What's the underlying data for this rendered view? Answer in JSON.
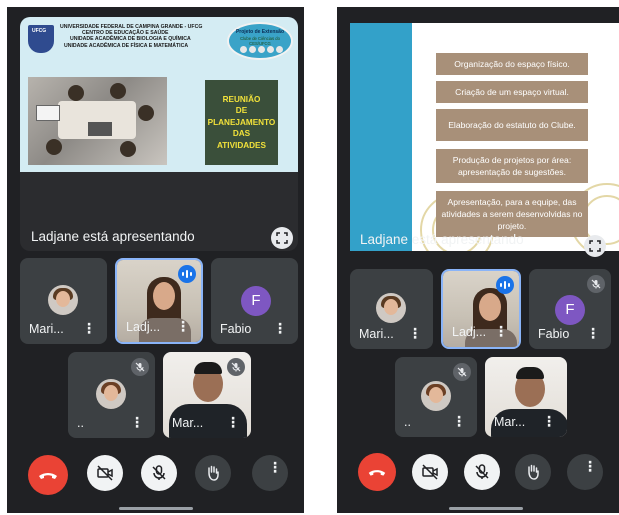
{
  "left_screen": {
    "slide": {
      "university_lines": [
        "UNIVERSIDADE FEDERAL DE CAMPINA GRANDE - UFCG",
        "CENTRO DE EDUCAÇÃO E SAÚDE",
        "UNIDADE ACADÊMICA DE BIOLOGIA E QUÍMICA",
        "UNIDADE ACADÊMICA DE FÍSICA E MATEMÁTICA"
      ],
      "logo_text": "UFCG",
      "badge_title": "Projeto de Extensão",
      "badge_subtitle": "Clube de Ciências do CES/UFCG",
      "title": "REUNIÃO\nDE\nPLANEJAMENTO\nDAS\nATIVIDADES"
    },
    "presenting_label": "Ladjane está apresentando",
    "participants": [
      {
        "name": "Mari...",
        "more": "⋮"
      },
      {
        "name": "Ladj...",
        "more": "⋮"
      },
      {
        "name": "Fabio",
        "more": "⋮",
        "initial": "F"
      },
      {
        "name": "..",
        "more": "⋮"
      },
      {
        "name": "Mar...",
        "more": "⋮"
      }
    ]
  },
  "right_screen": {
    "slide_items": [
      "Organização do espaço físico.",
      "Criação de um espaço virtual.",
      "Elaboração do estatuto do Clube.",
      "Produção de projetos por área: apresentação de sugestões.",
      "Apresentação, para a equipe, das atividades a serem desenvolvidas no projeto."
    ],
    "presenting_label": "Ladjane está apresentando",
    "participants": [
      {
        "name": "Mari...",
        "more": "⋮"
      },
      {
        "name": "Ladj...",
        "more": "⋮"
      },
      {
        "name": "Fabio",
        "more": "⋮",
        "initial": "F"
      },
      {
        "name": "..",
        "more": "⋮"
      },
      {
        "name": "Mar...",
        "more": "⋮"
      }
    ]
  },
  "controls": {
    "more_label": "⋮",
    "icons": [
      "end-call-icon",
      "camera-off-icon",
      "mic-off-icon",
      "raise-hand-icon",
      "more-options-icon"
    ]
  },
  "colors": {
    "background": "#202124",
    "tile": "#3c4043",
    "leave": "#ea4335",
    "speaking": "#1a73e8",
    "avatar_f": "#7e57c2"
  }
}
